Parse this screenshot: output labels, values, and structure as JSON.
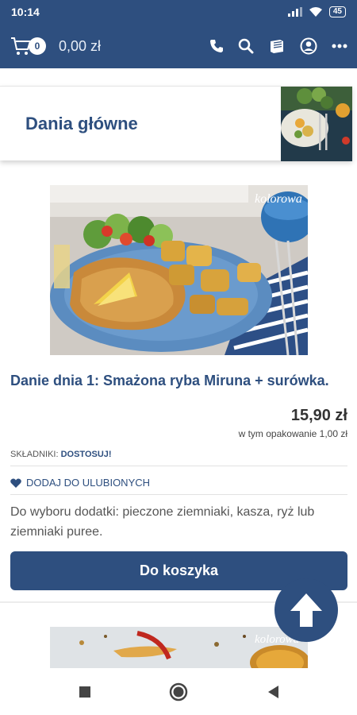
{
  "status": {
    "time": "10:14",
    "battery": "45"
  },
  "header": {
    "cart_count": "0",
    "cart_total": "0,00 zł"
  },
  "category": {
    "title": "Dania główne"
  },
  "product": {
    "name": "Danie dnia 1: Smażona ryba Miruna + surówka.",
    "price": "15,90 zł",
    "package_note": "w tym opakowanie 1,00 zł",
    "ingredients_label": "SKŁADNIKI:",
    "ingredients_link": "DOSTOSUJ!",
    "favorite_label": "DODAJ DO ULUBIONYCH",
    "description": "Do wyboru dodatki: pieczone ziemniaki, kasza, ryż lub ziemniaki puree.",
    "add_to_cart": "Do koszyka",
    "image_brand": "kolorowa"
  },
  "colors": {
    "primary": "#2e4f7f",
    "plate": "#5b8cc0"
  }
}
